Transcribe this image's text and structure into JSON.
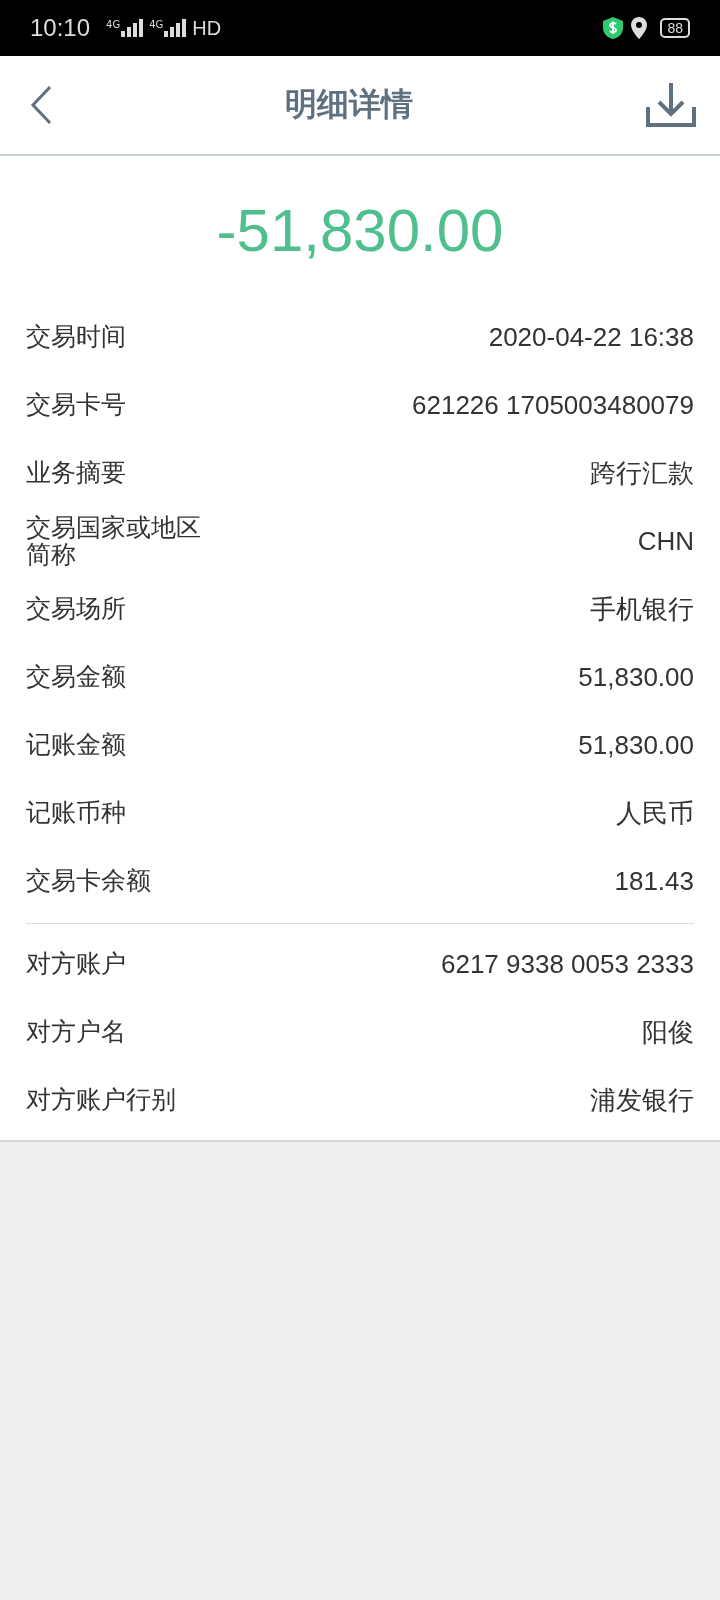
{
  "status_bar": {
    "time": "10:10",
    "networks": [
      "4G",
      "4G"
    ],
    "hd": "HD",
    "battery": "88"
  },
  "header": {
    "title": "明细详情"
  },
  "amount": "-51,830.00",
  "sections": [
    [
      {
        "label": "交易时间",
        "value": "2020-04-22 16:38"
      },
      {
        "label": "交易卡号",
        "value": "621226 1705003480079"
      },
      {
        "label": "业务摘要",
        "value": "跨行汇款"
      },
      {
        "label": "交易国家或地区简称",
        "value": "CHN"
      },
      {
        "label": "交易场所",
        "value": "手机银行"
      },
      {
        "label": "交易金额",
        "value": "51,830.00"
      },
      {
        "label": "记账金额",
        "value": "51,830.00"
      },
      {
        "label": "记账币种",
        "value": "人民币"
      },
      {
        "label": "交易卡余额",
        "value": "181.43"
      }
    ],
    [
      {
        "label": "对方账户",
        "value": "6217 9338 0053 2333"
      },
      {
        "label": "对方户名",
        "value": "阳俊"
      },
      {
        "label": "对方账户行别",
        "value": "浦发银行"
      }
    ]
  ]
}
